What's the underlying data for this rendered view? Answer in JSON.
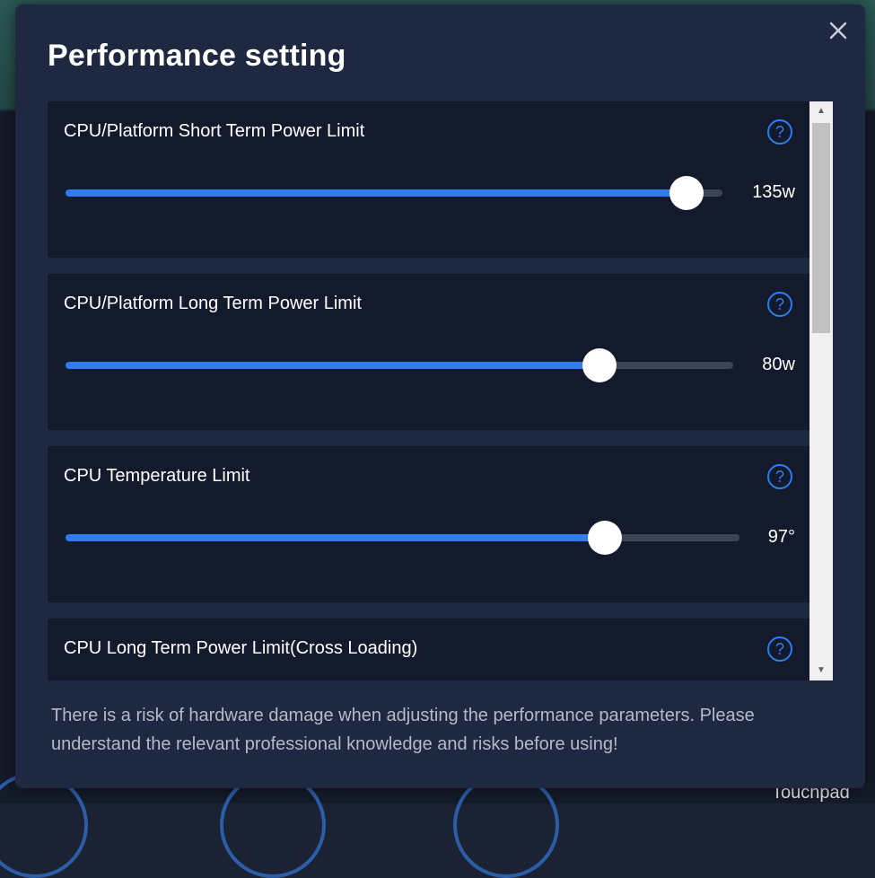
{
  "dialog": {
    "title": "Performance setting",
    "close_icon": "close-icon",
    "warning": "There is a risk of hardware damage when adjusting the performance parameters. Please understand the relevant professional knowledge and risks before using!"
  },
  "settings": [
    {
      "label": "CPU/Platform Short Term Power Limit",
      "value_text": "135w",
      "fill_fraction": 0.95,
      "help_icon": "help-icon"
    },
    {
      "label": "CPU/Platform Long Term Power Limit",
      "value_text": "80w",
      "fill_fraction": 0.8,
      "help_icon": "help-icon"
    },
    {
      "label": "CPU Temperature Limit",
      "value_text": "97°",
      "fill_fraction": 0.8,
      "help_icon": "help-icon"
    },
    {
      "label": "CPU Long Term Power Limit(Cross Loading)",
      "value_text": "",
      "fill_fraction": null,
      "help_icon": "help-icon"
    }
  ],
  "background": {
    "partial_label": "Touchpad"
  },
  "colors": {
    "accent": "#2f7bf2",
    "card": "#131a2c",
    "dialog": "#1e2941"
  }
}
